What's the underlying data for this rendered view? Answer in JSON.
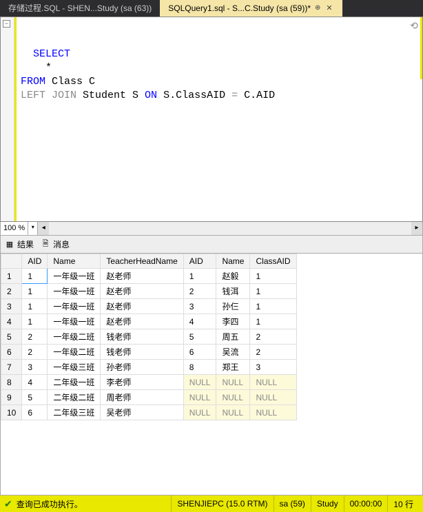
{
  "tabs": [
    {
      "label": "存储过程.SQL - SHEN...Study (sa (63))",
      "active": false
    },
    {
      "label": "SQLQuery1.sql - S...C.Study (sa (59))*",
      "active": true
    }
  ],
  "code": {
    "tokens": [
      [
        "kw",
        "SELECT"
      ],
      [
        "nl",
        ""
      ],
      [
        "txt",
        "    *"
      ],
      [
        "nl",
        ""
      ],
      [
        "kw",
        "FROM"
      ],
      [
        "txt",
        " Class C"
      ],
      [
        "nl",
        ""
      ],
      [
        "gray",
        "LEFT JOIN"
      ],
      [
        "txt",
        " Student S "
      ],
      [
        "kw",
        "ON"
      ],
      [
        "txt",
        " S.ClassAID "
      ],
      [
        "op",
        "="
      ],
      [
        "txt",
        " C.AID"
      ],
      [
        "nl",
        ""
      ]
    ]
  },
  "zoom": {
    "pct": "100 %"
  },
  "result_tabs": {
    "results": "结果",
    "messages": "消息"
  },
  "grid": {
    "columns": [
      "AID",
      "Name",
      "TeacherHeadName",
      "AID",
      "Name",
      "ClassAID"
    ],
    "rows": [
      [
        "1",
        "一年级一班",
        "赵老师",
        "1",
        "赵毅",
        "1"
      ],
      [
        "1",
        "一年级一班",
        "赵老师",
        "2",
        "钱洱",
        "1"
      ],
      [
        "1",
        "一年级一班",
        "赵老师",
        "3",
        "孙仨",
        "1"
      ],
      [
        "1",
        "一年级一班",
        "赵老师",
        "4",
        "李四",
        "1"
      ],
      [
        "2",
        "一年级二班",
        "钱老师",
        "5",
        "周五",
        "2"
      ],
      [
        "2",
        "一年级二班",
        "钱老师",
        "6",
        "吴流",
        "2"
      ],
      [
        "3",
        "一年级三班",
        "孙老师",
        "8",
        "郑王",
        "3"
      ],
      [
        "4",
        "二年级一班",
        "李老师",
        "NULL",
        "NULL",
        "NULL"
      ],
      [
        "5",
        "二年级二班",
        "周老师",
        "NULL",
        "NULL",
        "NULL"
      ],
      [
        "6",
        "二年级三班",
        "吴老师",
        "NULL",
        "NULL",
        "NULL"
      ]
    ]
  },
  "status": {
    "message": "查询已成功执行。",
    "server": "SHENJIEPC (15.0 RTM)",
    "user": "sa (59)",
    "db": "Study",
    "time": "00:00:00",
    "rows": "10 行"
  }
}
